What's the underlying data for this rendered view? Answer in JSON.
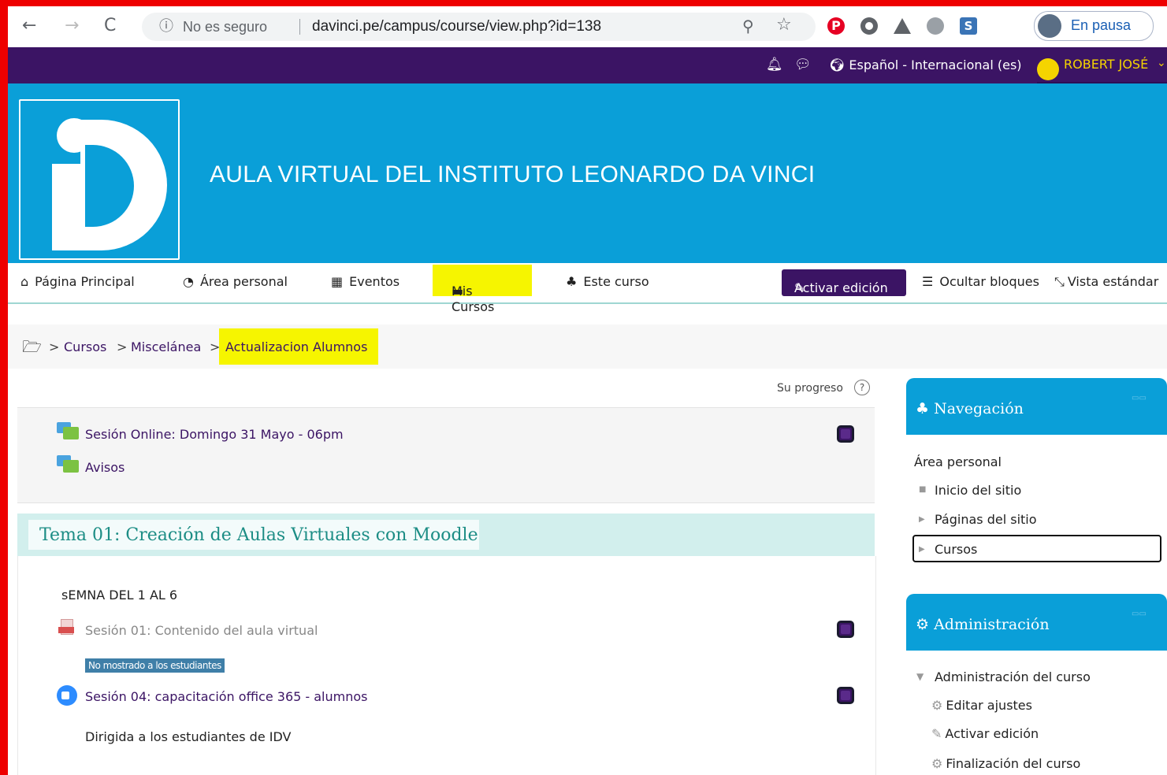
{
  "browser": {
    "insecure_label": "No es seguro",
    "url": "davinci.pe/campus/course/view.php?id=138",
    "profile_label": "En pausa"
  },
  "topbar": {
    "language": "Español - Internacional (es)",
    "user_name": "ROBERT JOSÉ"
  },
  "header": {
    "site_title": "AULA VIRTUAL DEL INSTITUTO LEONARDO DA VINCI"
  },
  "nav": {
    "home": "Página Principal",
    "personal_area": "Área personal",
    "events": "Eventos",
    "my_courses": "Mis Cursos",
    "this_course": "Este curso",
    "edit_mode": "Activar edición",
    "hide_blocks": "Ocultar bloques",
    "standard_view": "Vista estándar"
  },
  "breadcrumb": {
    "items": [
      "Cursos",
      "Miscelánea",
      "Actualizacion Alumnos"
    ]
  },
  "course": {
    "progress_label": "Su progreso",
    "section0_activities": [
      "Sesión Online: Domingo 31 Mayo - 06pm",
      "Avisos"
    ],
    "topic1": {
      "title": "Tema 01: Creación de Aulas Virtuales con Moodle",
      "summary": "sEMNA DEL 1 AL 6",
      "activities": [
        "Sesión 01: Contenido del aula virtual",
        "Sesión 04: capacitación office 365 - alumnos"
      ],
      "hidden_badge": "No mostrado a los estudiantes",
      "description": "Dirigida a los estudiantes de IDV"
    }
  },
  "blocks": {
    "navigation": {
      "title": "Navegación",
      "items": [
        "Área personal",
        "Inicio del sitio",
        "Páginas del sitio",
        "Cursos"
      ]
    },
    "administration": {
      "title": "Administración",
      "items": [
        "Administración del curso",
        "Editar ajustes",
        "Activar edición",
        "Finalización del curso"
      ]
    }
  }
}
